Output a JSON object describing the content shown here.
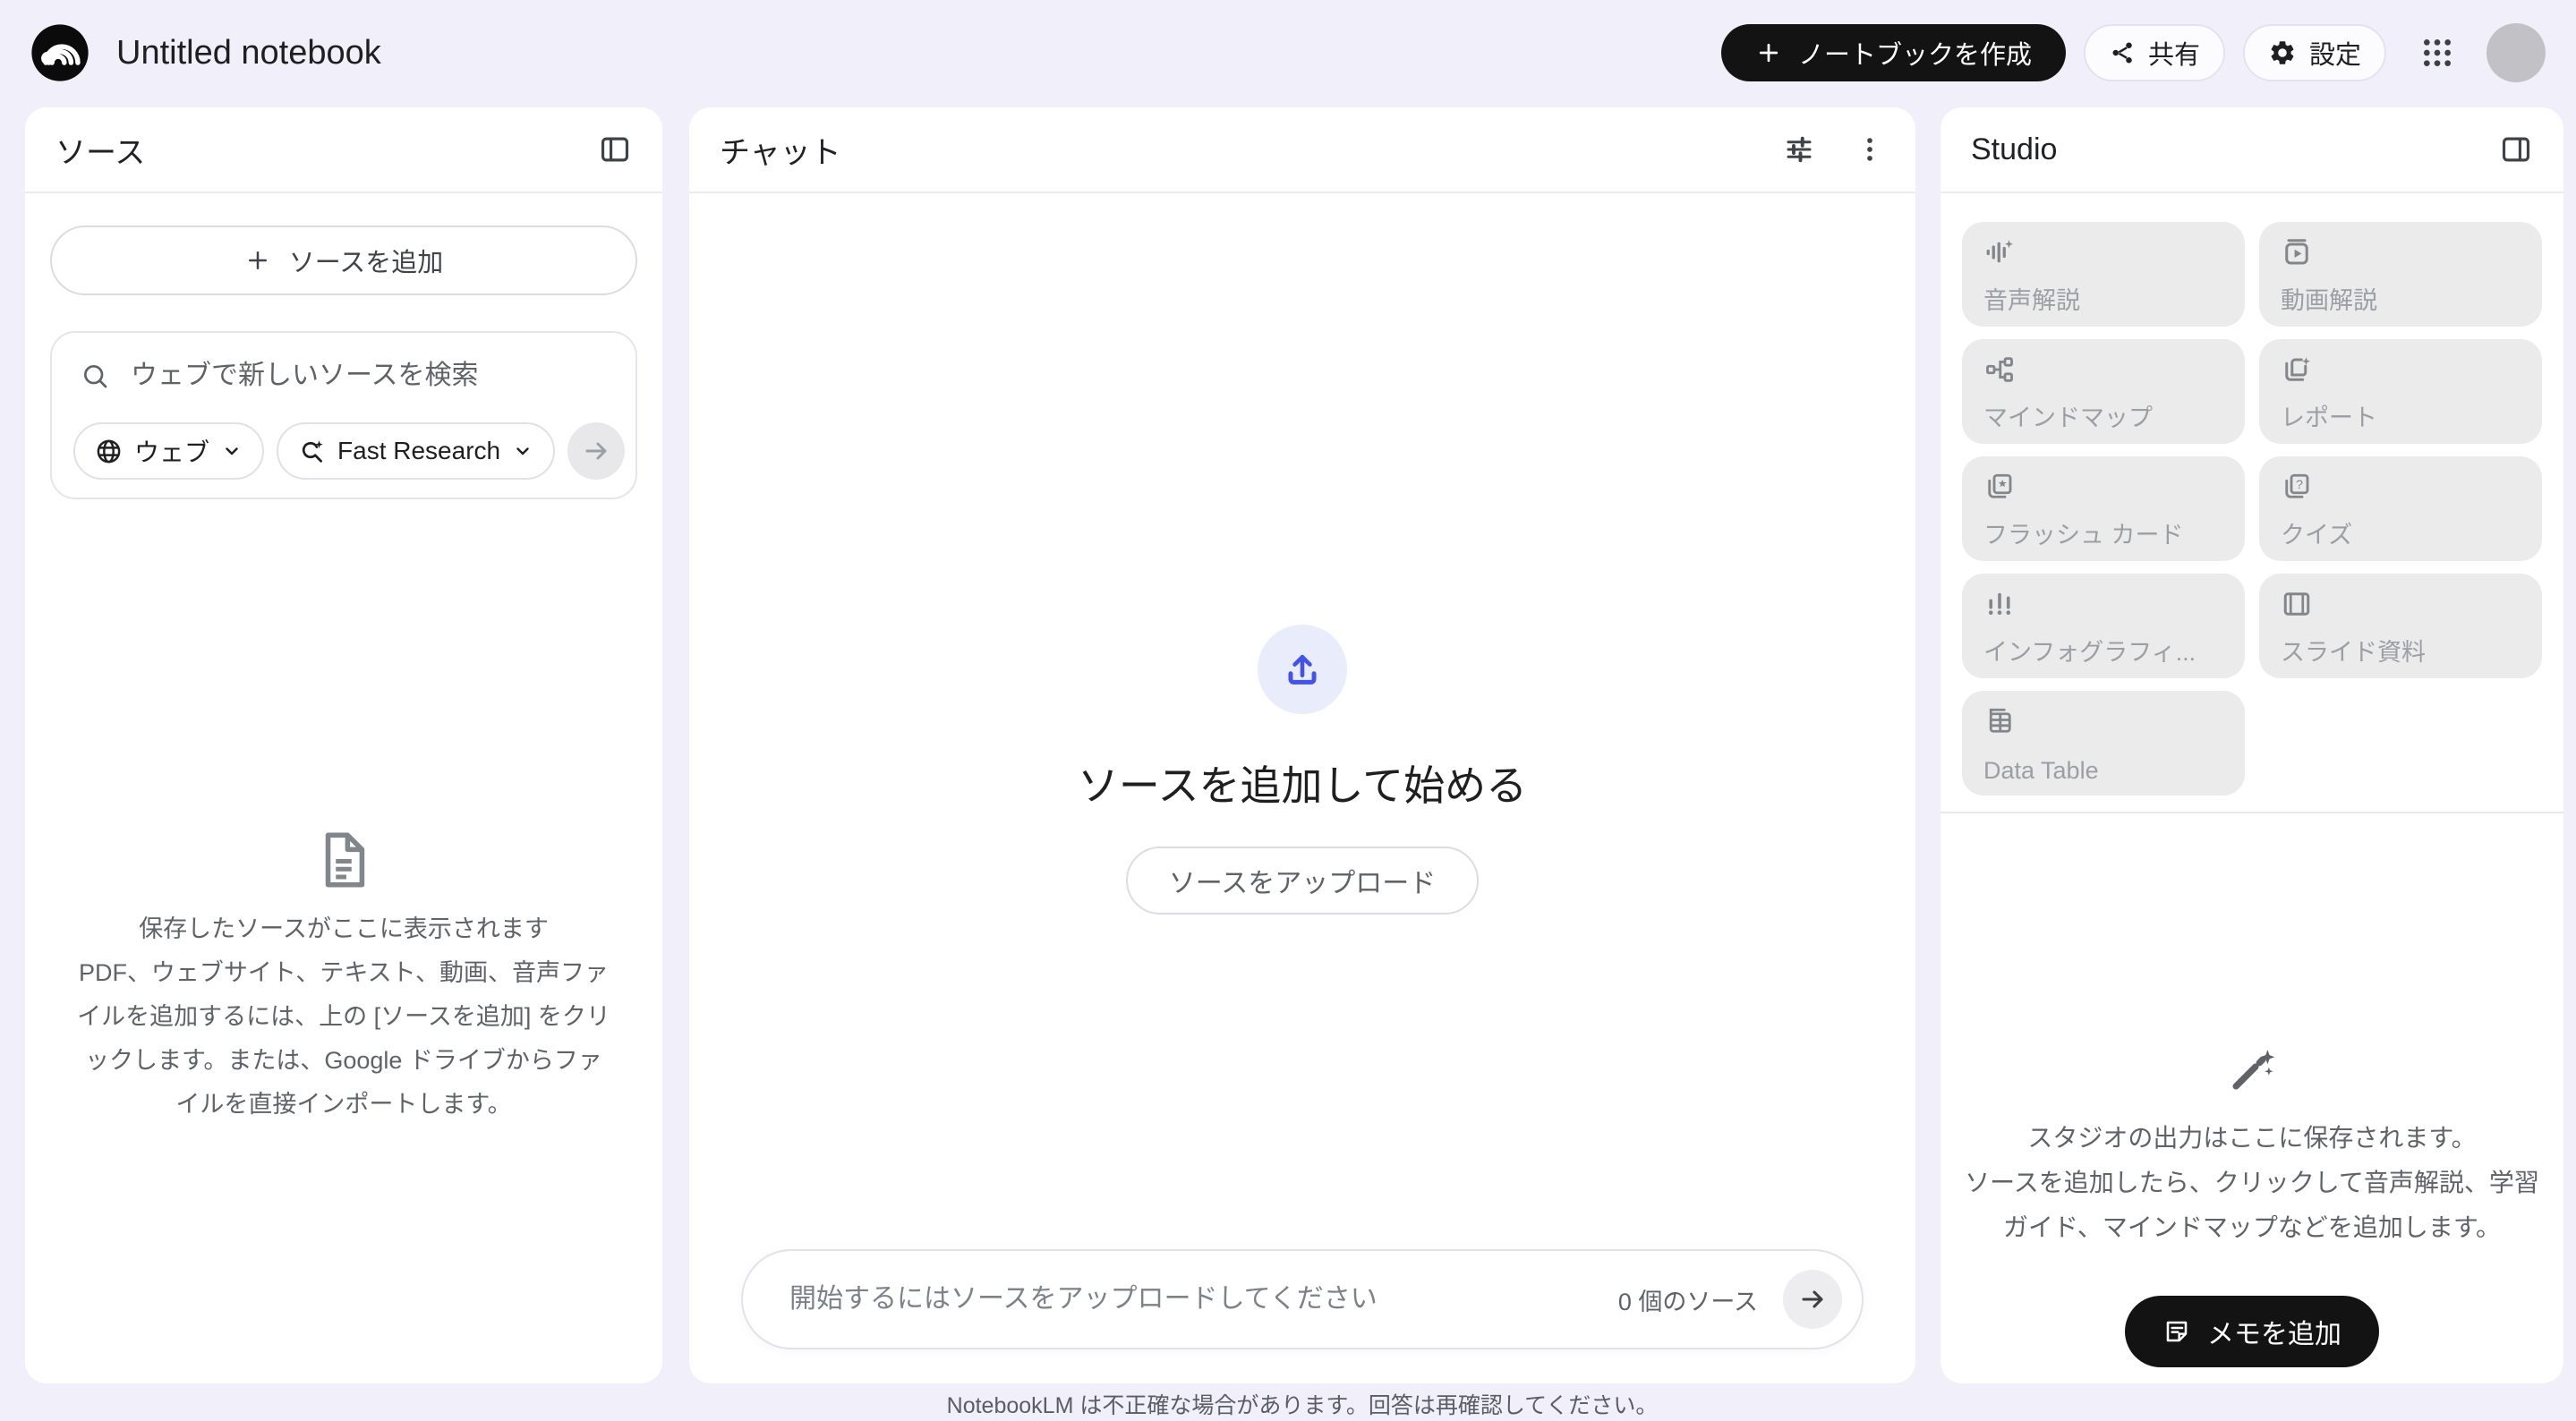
{
  "topbar": {
    "title": "Untitled notebook",
    "create_notebook_label": "ノートブックを作成",
    "share_label": "共有",
    "settings_label": "設定"
  },
  "sources": {
    "panel_title": "ソース",
    "add_source_label": "ソースを追加",
    "search_placeholder": "ウェブで新しいソースを検索",
    "web_chip_label": "ウェブ",
    "research_chip_label": "Fast Research",
    "empty_lines": [
      "保存したソースがここに表示されます",
      "PDF、ウェブサイト、テキスト、動画、音声ファ",
      "イルを追加するには、上の [ソースを追加] をクリ",
      "ックします。または、Google ドライブからファ",
      "イルを直接インポートします。"
    ]
  },
  "chat": {
    "panel_title": "チャット",
    "empty_title": "ソースを追加して始める",
    "upload_button_label": "ソースをアップロード",
    "input_placeholder": "開始するにはソースをアップロードしてください",
    "source_count_label": "0 個のソース"
  },
  "studio": {
    "panel_title": "Studio",
    "tiles": [
      {
        "label": "音声解説",
        "icon": "audio-overview-icon"
      },
      {
        "label": "動画解説",
        "icon": "video-overview-icon"
      },
      {
        "label": "マインドマップ",
        "icon": "mind-map-icon"
      },
      {
        "label": "レポート",
        "icon": "report-icon"
      },
      {
        "label": "フラッシュ カード",
        "icon": "flashcards-icon"
      },
      {
        "label": "クイズ",
        "icon": "quiz-icon"
      },
      {
        "label": "インフォグラフィ...",
        "icon": "infographic-icon"
      },
      {
        "label": "スライド資料",
        "icon": "slides-icon"
      },
      {
        "label": "Data Table",
        "icon": "data-table-icon"
      }
    ],
    "empty_lines": [
      "スタジオの出力はここに保存されます。",
      "ソースを追加したら、クリックして音声解説、学習",
      "ガイド、マインドマップなどを追加します。"
    ],
    "add_note_label": "メモを追加"
  },
  "footer": {
    "disclaimer": "NotebookLM は不正確な場合があります。回答は再確認してください。"
  },
  "colors": {
    "page_bg": "#f0effa",
    "panel_bg": "#ffffff",
    "accent_blue": "#4353e9",
    "upload_bubble_bg": "#e9ecfb",
    "black_button": "#131314",
    "tile_bg": "#ebebeb",
    "text_primary": "#1f1f1f",
    "text_secondary": "#5f6368",
    "text_disabled": "#9aa0a6"
  }
}
